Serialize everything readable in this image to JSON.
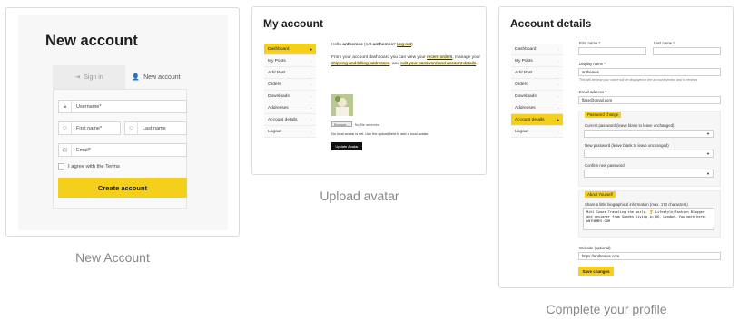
{
  "new_account": {
    "title": "New account",
    "tab_signin": "Sign in",
    "tab_new": "New account",
    "username_placeholder": "Username*",
    "firstname_placeholder": "First name*",
    "lastname_placeholder": "Last name",
    "email_placeholder": "Email*",
    "agree_label": "I agree with the Terms",
    "create_button": "Create account",
    "caption": "New Account"
  },
  "my_account": {
    "title": "My account",
    "nav": [
      {
        "label": "Dashboard",
        "active": true
      },
      {
        "label": "My Posts",
        "active": false
      },
      {
        "label": "Add Post",
        "active": false
      },
      {
        "label": "Orders",
        "active": false
      },
      {
        "label": "Downloads",
        "active": false
      },
      {
        "label": "Addresses",
        "active": false
      },
      {
        "label": "Account details",
        "active": false
      },
      {
        "label": "Logout",
        "active": false
      }
    ],
    "hello_prefix": "Hello",
    "hello_user": "anthemes",
    "hello_not": "(not",
    "hello_user2": "anthemes",
    "hello_q": "?",
    "logout_link": "Log out",
    "hello_close": ")",
    "dash_text_1": "From your account dashboard you can view your",
    "recent_orders": "recent orders",
    "dash_text_2": ", manage your",
    "shipping_link": "shipping and billing addresses",
    "dash_text_3": ", and",
    "password_link": "edit your password and account details",
    "dash_text_4": ".",
    "choose_file": "Browse...",
    "no_file": "No file selected.",
    "avatar_note": "No local avatar is set. Use the upload field to add a local avatar.",
    "upload_button": "Update Avatar",
    "caption": "Upload avatar"
  },
  "account_details": {
    "title": "Account details",
    "nav": [
      {
        "label": "Dashboard",
        "active": false
      },
      {
        "label": "My Posts",
        "active": false
      },
      {
        "label": "Add Post",
        "active": false
      },
      {
        "label": "Orders",
        "active": false
      },
      {
        "label": "Downloads",
        "active": false
      },
      {
        "label": "Addresses",
        "active": false
      },
      {
        "label": "Account details",
        "active": true
      },
      {
        "label": "Logout",
        "active": false
      }
    ],
    "first_name_label": "First name *",
    "last_name_label": "Last name *",
    "display_name_label": "Display name *",
    "display_name_value": "anthemes",
    "display_name_note": "This will be how your name will be displayed in the account section and in reviews",
    "email_label": "Email address *",
    "email_value": "flake@gmail.com",
    "password_legend": "Password change",
    "current_password_label": "Current password (leave blank to leave unchanged)",
    "new_password_label": "New password (leave blank to leave unchanged)",
    "confirm_password_label": "Confirm new password",
    "about_legend": "About Yourself",
    "bio_label": "Share a little biographical information (max. 170 characters)",
    "bio_value": "Mikl Inoes Traveling the world. 🏆 Lifestyle/Fashion Blogger and designer from Sweden living in UK, London. You more here: ANTHEMES.COM",
    "website_label": "Website (optional)",
    "website_value": "https://anthemes.com",
    "save_button": "Save changes",
    "caption": "Complete your profile"
  },
  "colors": {
    "accent": "#f4cf1b",
    "border": "#dcdcdc",
    "caption": "#888888"
  }
}
